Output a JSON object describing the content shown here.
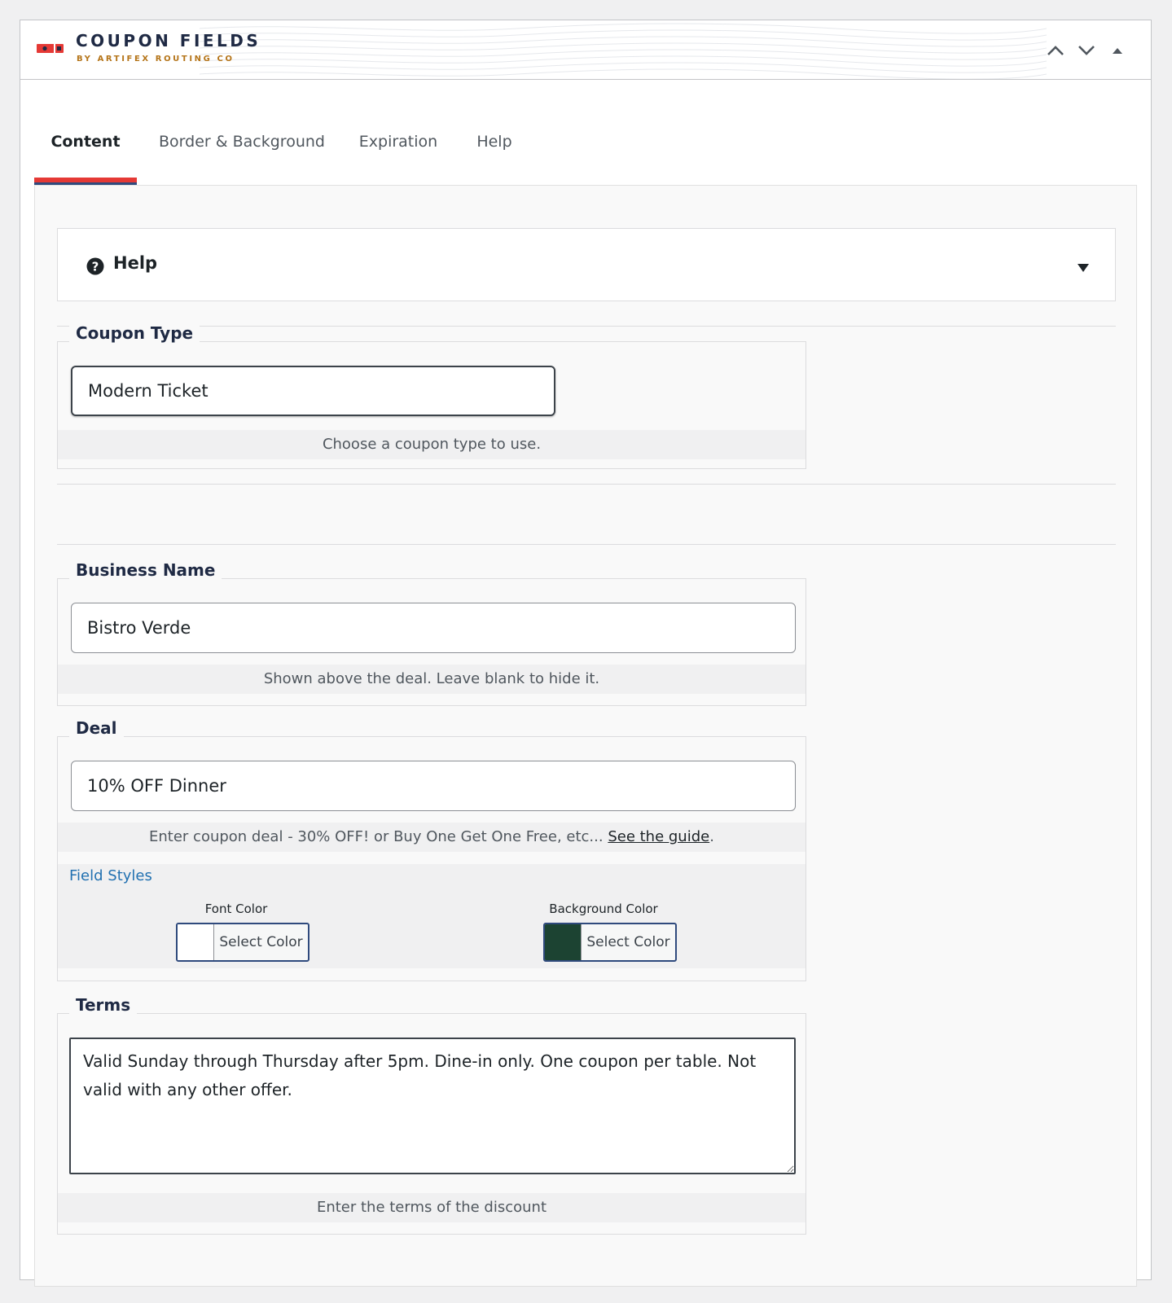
{
  "header": {
    "title": "COUPON FIELDS",
    "subtitle": "BY ARTIFEX ROUTING CO",
    "brand_colors": {
      "red": "#e53935",
      "navy": "#1f2a44",
      "gold": "#b5751a"
    },
    "controls": [
      "chevron-up-icon",
      "chevron-down-icon",
      "triangle-up-icon"
    ]
  },
  "tabs": [
    {
      "label": "Content",
      "active": true
    },
    {
      "label": "Border & Background",
      "active": false
    },
    {
      "label": "Expiration",
      "active": false
    },
    {
      "label": "Help",
      "active": false
    }
  ],
  "help": {
    "title": "Help",
    "icon": "question-circle-icon",
    "toggle_icon": "caret-down-icon"
  },
  "coupon_type": {
    "legend": "Coupon Type",
    "value": "Modern Ticket",
    "description": "Choose a coupon type to use."
  },
  "business_name": {
    "legend": "Business Name",
    "value": "Bistro Verde",
    "description": "Shown above the deal. Leave blank to hide it."
  },
  "deal": {
    "legend": "Deal",
    "value": "10% OFF Dinner",
    "description_text": "Enter coupon deal - 30% OFF! or Buy One Get One Free, etc...",
    "description_link": "See the guide",
    "description_end": ".",
    "field_styles_label": "Field Styles",
    "font_color": {
      "label": "Font Color",
      "button": "Select Color",
      "swatch": "#ffffff"
    },
    "background_color": {
      "label": "Background Color",
      "button": "Select Color",
      "swatch": "#1c4332"
    }
  },
  "terms": {
    "legend": "Terms",
    "value": "Valid Sunday through Thursday after 5pm. Dine-in only. One coupon per table. Not valid with any other offer.",
    "description": "Enter the terms of the discount"
  }
}
